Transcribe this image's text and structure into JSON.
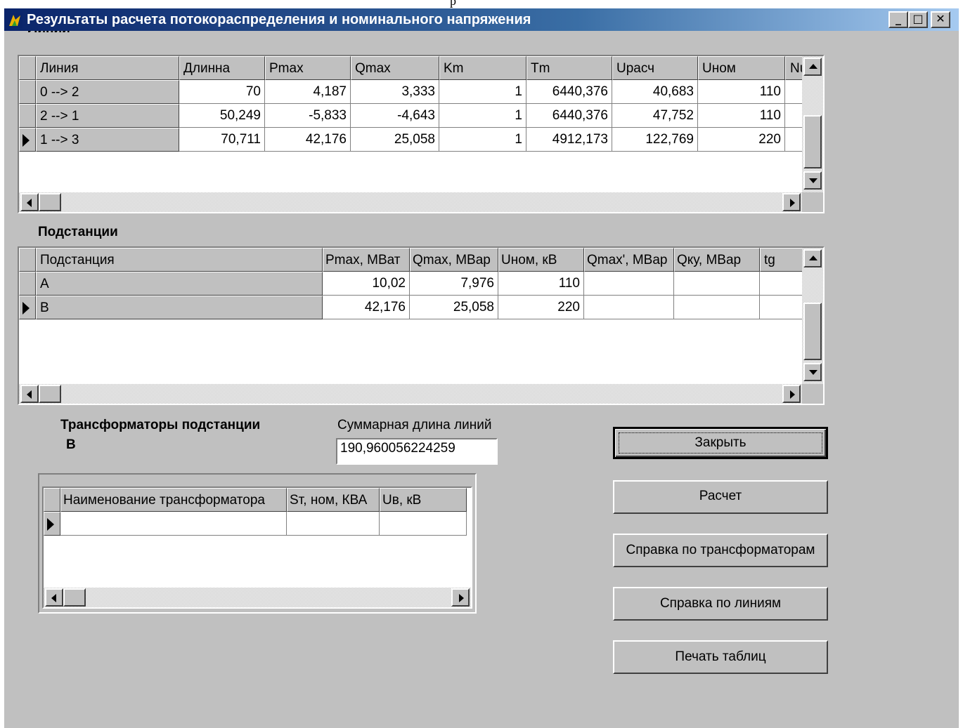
{
  "window": {
    "title": "Результаты расчета потокораспределения и номинального напряжения",
    "behind_text": "р",
    "controls": {
      "minimize": "_",
      "maximize": "□",
      "close": "✕"
    }
  },
  "lines_section": {
    "label": "Линии",
    "columns": [
      "Линия",
      "Длинна",
      "Pmax",
      "Qmax",
      "Km",
      "Tm",
      "Uрасч",
      "Uном",
      "Num"
    ],
    "rows": [
      [
        "0 --> 2",
        "70",
        "4,187",
        "3,333",
        "1",
        "6440,376",
        "40,683",
        "110",
        ""
      ],
      [
        "2 --> 1",
        "50,249",
        "-5,833",
        "-4,643",
        "1",
        "6440,376",
        "47,752",
        "110",
        ""
      ],
      [
        "1 --> 3",
        "70,711",
        "42,176",
        "25,058",
        "1",
        "4912,173",
        "122,769",
        "220",
        ""
      ]
    ],
    "current_row": 2
  },
  "substations_section": {
    "label": "Подстанции",
    "columns": [
      "Подстанция",
      "Pmax, MBат",
      "Qmax, MBap",
      "Uном, кВ",
      "Qmax', MBap",
      "Qку,  MBap",
      "tg"
    ],
    "rows": [
      [
        "A",
        "10,02",
        "7,976",
        "110",
        "",
        "",
        ""
      ],
      [
        "B",
        "42,176",
        "25,058",
        "220",
        "",
        "",
        ""
      ]
    ],
    "current_row": 1
  },
  "transformers_section": {
    "label_line1": "Трансформаторы подстанции",
    "label_line2": "B",
    "columns": [
      "Наименование трансформатора",
      "Sт, ном, КВА",
      "Uв, кВ"
    ]
  },
  "total_length": {
    "label": "Суммарная длина линий",
    "value": "190,960056224259"
  },
  "buttons": {
    "close": "Закрыть",
    "calculate": "Расчет",
    "help_transformers": "Справка по трансформаторам",
    "help_lines": "Справка по линиям",
    "print_tables": "Печать таблиц"
  }
}
